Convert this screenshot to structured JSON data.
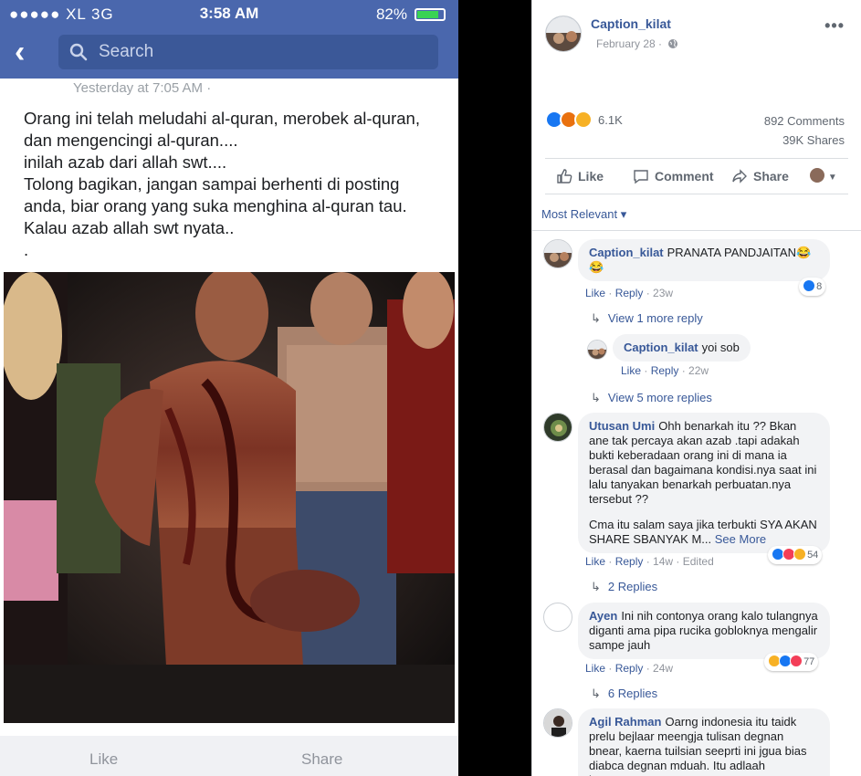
{
  "phone": {
    "carrier": "●●●●● XL  3G",
    "time": "3:58 AM",
    "battery": "82%",
    "battery_level": 0.82,
    "search_placeholder": "Search",
    "post_timestamp": "Yesterday at 7:05 AM · ",
    "post_text": "Orang ini telah meludahi al-quran, merobek al-quran,\ndan mengencingi al-quran....\ninilah azab dari allah swt....\nTolong bagikan, jangan sampai berhenti di posting\nanda, biar orang yang suka menghina al-quran tau.\nKalau azab allah swt nyata..\n.",
    "like_label": "Like",
    "share_label": "Share"
  },
  "post": {
    "page_name": "Caption_kilat",
    "date": "February 28 · ",
    "reaction_count": "6.1K",
    "comments": "892 Comments",
    "shares": "39K Shares",
    "like": "Like",
    "comment": "Comment",
    "share": "Share",
    "sort": "Most Relevant ▾"
  },
  "comments": [
    {
      "author": "Caption_kilat",
      "text": "PRANATA PANDJAITAN😂😂",
      "like": "Like",
      "reply": "Reply",
      "time": "23w",
      "reactions": "8",
      "more": "View 1 more reply"
    },
    {
      "author": "Caption_kilat",
      "text": "yoi sob",
      "like": "Like",
      "reply": "Reply",
      "time": "22w",
      "more": "View 5 more replies"
    },
    {
      "author": "Utusan Umi",
      "text": "Ohh benarkah itu ?? Bkan ane tak percaya akan azab .tapi adakah bukti keberadaan orang ini di mana ia berasal dan bagaimana kondisi.nya saat ini lalu tanyakan benarkah perbuatan.nya tersebut ??",
      "text2": "Cma itu salam saya jika terbukti SYA AKAN SHARE SBANYAK M...",
      "see_more": "See More",
      "like": "Like",
      "reply": "Reply",
      "time": "14w",
      "edited": "Edited",
      "reactions": "54",
      "more": "2 Replies"
    },
    {
      "author": "Ayen",
      "text": "Ini nih contonya orang kalo tulangnya diganti ama pipa rucika gobloknya mengalir sampe jauh",
      "like": "Like",
      "reply": "Reply",
      "time": "24w",
      "reactions": "77",
      "more": "6 Replies"
    },
    {
      "author": "Agil Rahman",
      "text": "Oarng indonesia itu taidk prelu bejlaar meengja tulisan degnan bnear, kaerna tuilsian seeprti ini jgua bias diabca degnan mduah. Itu adlaah kempamuan"
    }
  ],
  "colors": {
    "facebook_blue": "#4a67ad",
    "link_blue": "#385898",
    "like_blue": "#1877f2",
    "love_red": "#f33e58",
    "haha_yellow": "#f7b125"
  },
  "icons": [
    "back-chevron-icon",
    "search-icon",
    "globe-icon",
    "more-icon",
    "like-icon",
    "comment-icon",
    "share-icon",
    "reply-arrow-icon"
  ]
}
